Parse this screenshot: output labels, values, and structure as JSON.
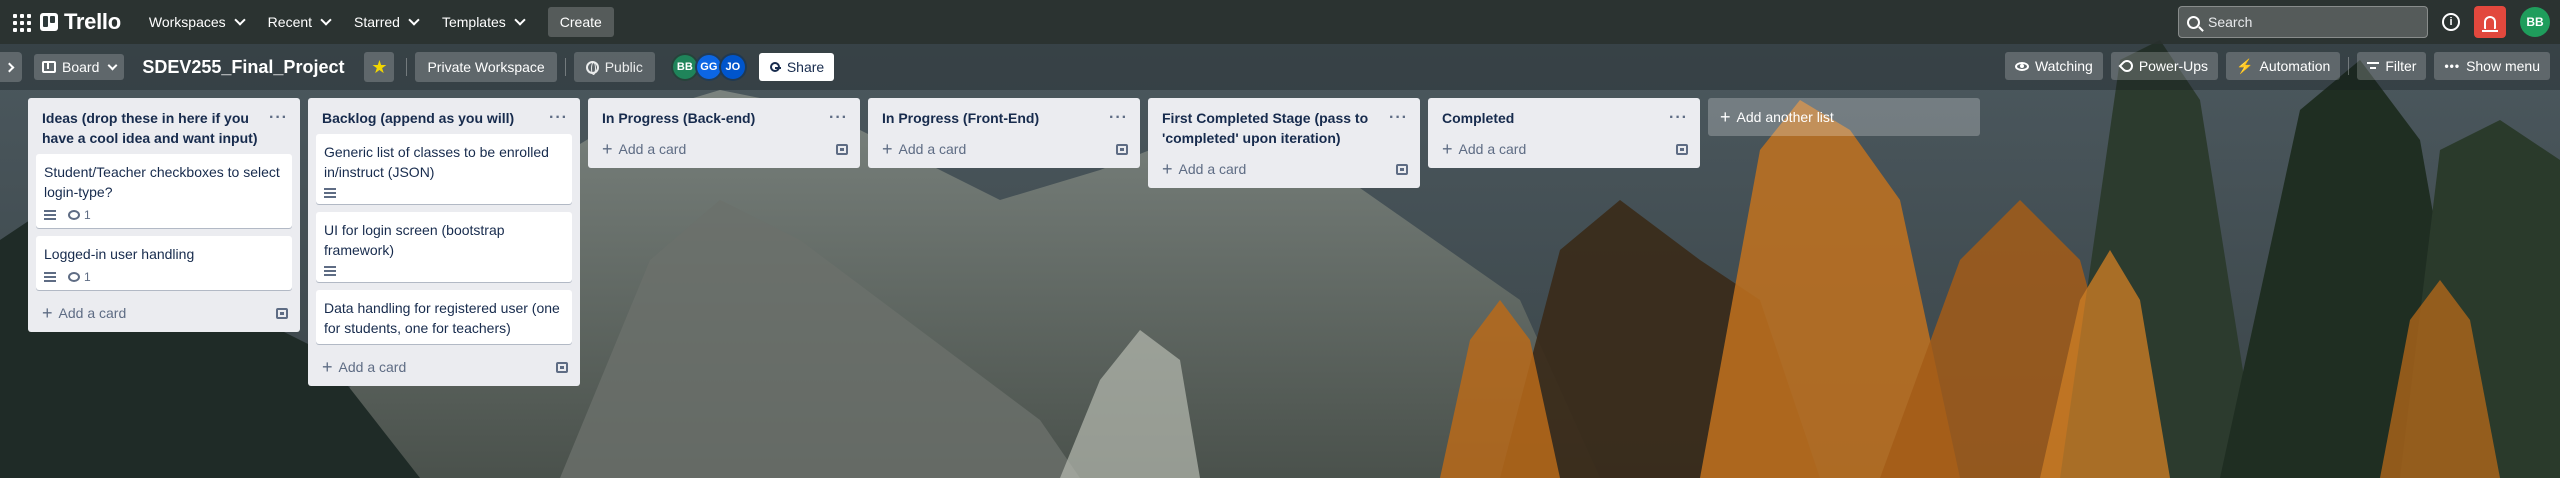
{
  "header": {
    "app_name": "Trello",
    "nav": [
      {
        "label": "Workspaces"
      },
      {
        "label": "Recent"
      },
      {
        "label": "Starred"
      },
      {
        "label": "Templates"
      }
    ],
    "create_label": "Create",
    "search_placeholder": "Search",
    "user_initials": "BB"
  },
  "board_bar": {
    "view_label": "Board",
    "title": "SDEV255_Final_Project",
    "workspace_label": "Private Workspace",
    "visibility_label": "Public",
    "members": [
      {
        "initials": "BB",
        "color": "#1f845a"
      },
      {
        "initials": "GG",
        "color": "#0c66e4"
      },
      {
        "initials": "JO",
        "color": "#0055cc"
      }
    ],
    "share_label": "Share",
    "watching_label": "Watching",
    "powerups_label": "Power-Ups",
    "automation_label": "Automation",
    "filter_label": "Filter",
    "show_menu_label": "Show menu"
  },
  "lists": [
    {
      "title": "Ideas (drop these in here if you have a cool idea and want input)",
      "cards": [
        {
          "title": "Student/Teacher checkboxes to select login-type?",
          "has_description": true,
          "comments": "1"
        },
        {
          "title": "Logged-in user handling",
          "has_description": true,
          "comments": "1"
        }
      ],
      "add_label": "Add a card"
    },
    {
      "title": "Backlog (append as you will)",
      "cards": [
        {
          "title": "Generic list of classes to be enrolled in/instruct (JSON)",
          "has_description": true,
          "comments": ""
        },
        {
          "title": "UI for login screen (bootstrap framework)",
          "has_description": true,
          "comments": ""
        },
        {
          "title": "Data handling for registered user (one for students, one for teachers)",
          "has_description": false,
          "comments": ""
        }
      ],
      "add_label": "Add a card"
    },
    {
      "title": "In Progress (Back-end)",
      "cards": [],
      "add_label": "Add a card"
    },
    {
      "title": "In Progress (Front-End)",
      "cards": [],
      "add_label": "Add a card"
    },
    {
      "title": "First Completed Stage (pass to 'completed' upon iteration)",
      "cards": [],
      "add_label": "Add a card"
    },
    {
      "title": "Completed",
      "cards": [],
      "add_label": "Add a card"
    }
  ],
  "add_list_label": "Add another list"
}
